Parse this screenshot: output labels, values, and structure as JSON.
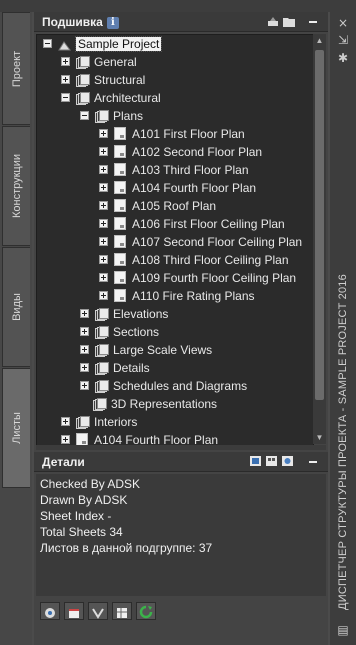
{
  "tabs": [
    {
      "label": "Проект"
    },
    {
      "label": "Конструкции"
    },
    {
      "label": "Виды"
    },
    {
      "label": "Листы"
    }
  ],
  "panel_title": "Подшивка",
  "info_icon_glyph": "i",
  "tree": [
    {
      "label": "Sample Project"
    },
    {
      "label": "General"
    },
    {
      "label": "Structural"
    },
    {
      "label": "Architectural"
    },
    {
      "label": "Plans"
    },
    {
      "label": "A101 First Floor Plan"
    },
    {
      "label": "A102 Second Floor Plan"
    },
    {
      "label": "A103 Third Floor Plan"
    },
    {
      "label": "A104 Fourth Floor Plan"
    },
    {
      "label": "A105 Roof Plan"
    },
    {
      "label": "A106 First Floor Ceiling Plan"
    },
    {
      "label": "A107 Second Floor Ceiling Plan"
    },
    {
      "label": "A108 Third Floor Ceiling Plan"
    },
    {
      "label": "A109 Fourth Floor Ceiling Plan"
    },
    {
      "label": "A110 Fire Rating Plans"
    },
    {
      "label": "Elevations"
    },
    {
      "label": "Sections"
    },
    {
      "label": "Large Scale Views"
    },
    {
      "label": "Details"
    },
    {
      "label": "Schedules and Diagrams"
    },
    {
      "label": "3D Representations"
    },
    {
      "label": "Interiors"
    },
    {
      "label": "A104 Fourth Floor Plan"
    }
  ],
  "details": {
    "title": "Детали",
    "lines": [
      "Checked By ADSK",
      "Drawn By ADSK",
      "Sheet Index -",
      "Total Sheets 34",
      "Листов в данной подгруппе: 37"
    ]
  },
  "side_title": "ДИСПЕТЧЕР СТРУКТУРЫ ПРОЕКТА - SAMPLE PROJECT 2016",
  "close_glyph": "×",
  "colors": {
    "background": "#444444",
    "tree_bg": "#2b2b2b",
    "refresh_green": "#3bb34a"
  }
}
